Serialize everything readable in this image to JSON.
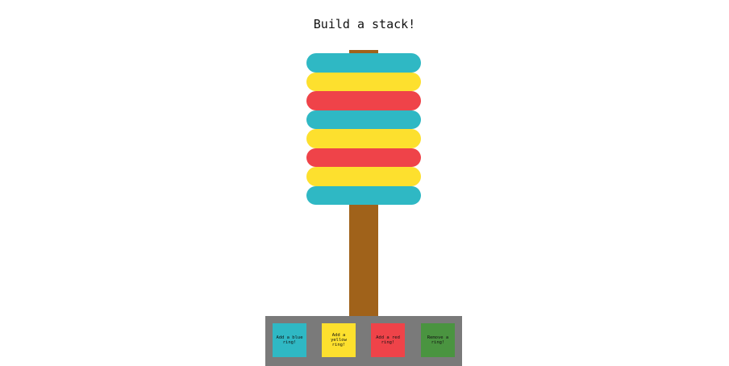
{
  "title": "Build a stack!",
  "colors": {
    "blue": "#2fb8c4",
    "yellow": "#fde02e",
    "red": "#ef4349",
    "green": "#4a9440",
    "pole": "#a0621a",
    "base": "#7a7a7a"
  },
  "rings": [
    {
      "color": "blue"
    },
    {
      "color": "yellow"
    },
    {
      "color": "red"
    },
    {
      "color": "blue"
    },
    {
      "color": "yellow"
    },
    {
      "color": "red"
    },
    {
      "color": "yellow"
    },
    {
      "color": "blue"
    }
  ],
  "controls": {
    "add_blue": "Add a blue ring!",
    "add_yellow": "Add a yellow ring!",
    "add_red": "Add a red ring!",
    "remove": "Remove a ring!"
  }
}
